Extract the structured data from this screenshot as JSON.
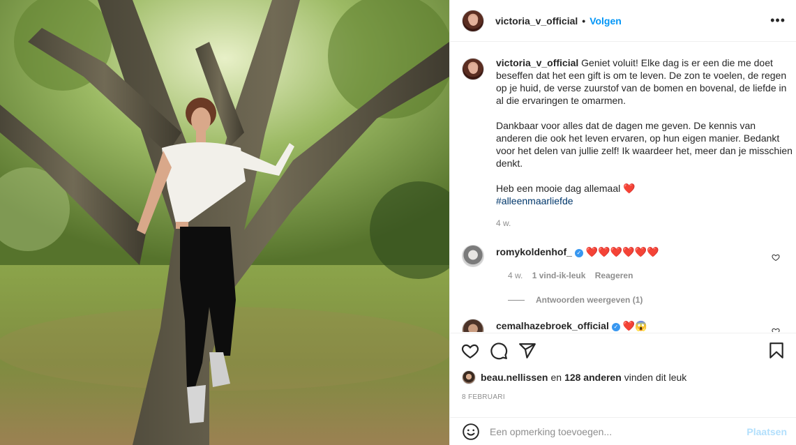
{
  "post_header": {
    "username": "victoria_v_official",
    "separator": "•",
    "follow_label": "Volgen",
    "more_label": "•••"
  },
  "caption": {
    "username": "victoria_v_official",
    "paragraph1": "Geniet voluit! Elke dag is er een die me doet beseffen dat het een gift is om te leven. De zon te voelen, de regen op je huid, de verse zuurstof van de bomen en bovenal, de liefde in al die ervaringen te omarmen.",
    "paragraph2": "Dankbaar voor alles dat de dagen me geven. De kennis van anderen die ook het leven ervaren, op hun eigen manier. Bedankt voor het delen van jullie zelf! Ik waardeer het, meer dan je misschien denkt.",
    "paragraph3": "Heb een mooie dag allemaal",
    "paragraph3_emoji": "❤️",
    "hashtag": "#alleenmaarliefde",
    "age": "4 w."
  },
  "comments": [
    {
      "username": "romykoldenhof_",
      "text": "❤️❤️❤️❤️❤️❤️",
      "age": "4 w.",
      "likes": "1 vind-ik-leuk",
      "reply_label": "Reageren",
      "view_replies": "Antwoorden weergeven (1)"
    },
    {
      "username": "cemalhazebroek_official",
      "text": "❤️😱"
    }
  ],
  "likes": {
    "first_liker": "beau.nellissen",
    "connector": "en",
    "others": "128 anderen",
    "suffix": "vinden dit leuk"
  },
  "date": "8 FEBRUARI",
  "add_comment": {
    "placeholder": "Een opmerking toevoegen...",
    "post_label": "Plaatsen"
  },
  "icons": {
    "like": "heart-icon",
    "comment": "comment-icon",
    "share": "paper-plane-icon",
    "save": "bookmark-icon",
    "emoji": "smiley-icon",
    "verified": "verified-badge-icon"
  },
  "colors": {
    "link_blue": "#0095f6",
    "hashtag": "#00376b",
    "heart_red": "#e4252e",
    "muted": "#8e8e8e",
    "post_disabled": "#b2dffc"
  }
}
